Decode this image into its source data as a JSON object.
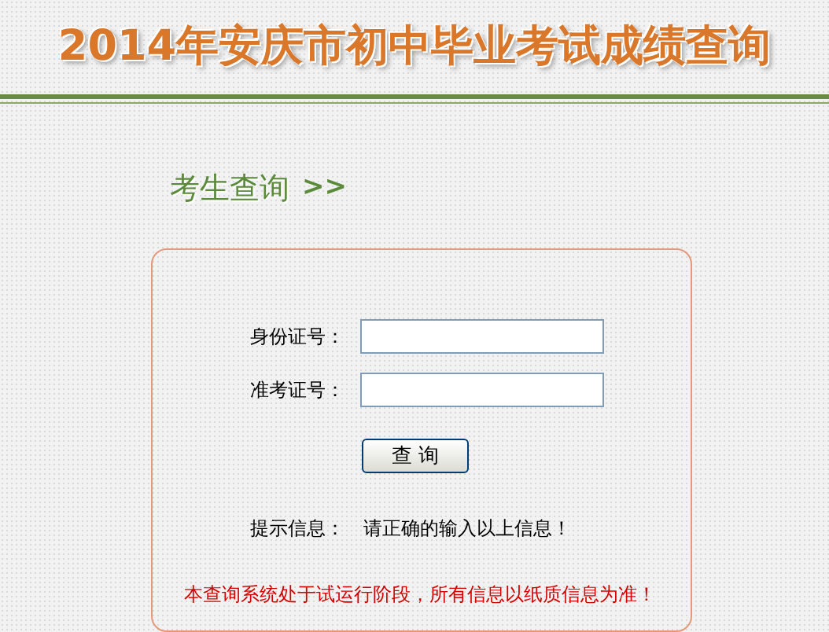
{
  "title": "2014年安庆市初中毕业考试成绩查询",
  "section": {
    "title": "考生查询",
    "arrow": ">>"
  },
  "fields": [
    {
      "label": "身份证号："
    },
    {
      "label": "准考证号："
    }
  ],
  "button": "查 询",
  "hint": {
    "label": "提示信息：",
    "text": "请正确的输入以上信息！"
  },
  "notice": "本查询系统处于试运行阶段，所有信息以纸质信息为准！"
}
